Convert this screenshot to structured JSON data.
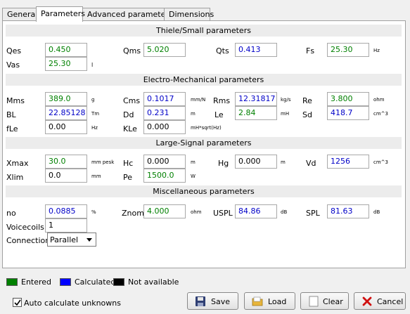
{
  "tabs": [
    "General",
    "Parameters",
    "Advanced parameters",
    "Dimensions"
  ],
  "sections": {
    "ts": "Thiele/Small parameters",
    "em": "Electro-Mechanical parameters",
    "ls": "Large-Signal parameters",
    "misc": "Miscellaneous parameters"
  },
  "params": {
    "qes": {
      "label": "Qes",
      "value": "0.450",
      "unit": ""
    },
    "qms": {
      "label": "Qms",
      "value": "5.020",
      "unit": ""
    },
    "qts": {
      "label": "Qts",
      "value": "0.413",
      "unit": ""
    },
    "fs": {
      "label": "Fs",
      "value": "25.30",
      "unit": "Hz"
    },
    "vas": {
      "label": "Vas",
      "value": "25.30",
      "unit": "l"
    },
    "mms": {
      "label": "Mms",
      "value": "389.0",
      "unit": "g"
    },
    "cms": {
      "label": "Cms",
      "value": "0.1017",
      "unit": "mm/N"
    },
    "rms": {
      "label": "Rms",
      "value": "12.31817",
      "unit": "kg/s"
    },
    "re": {
      "label": "Re",
      "value": "3.800",
      "unit": "ohm"
    },
    "bl": {
      "label": "BL",
      "value": "22.85128",
      "unit": "Tm"
    },
    "dd": {
      "label": "Dd",
      "value": "0.231",
      "unit": "m"
    },
    "le": {
      "label": "Le",
      "value": "2.84",
      "unit": "mH"
    },
    "sd": {
      "label": "Sd",
      "value": "418.7",
      "unit": "cm^3"
    },
    "fle": {
      "label": "fLe",
      "value": "0.00",
      "unit": "Hz"
    },
    "kle": {
      "label": "KLe",
      "value": "0.000",
      "unit": "mH*sqrt(Hz)"
    },
    "xmax": {
      "label": "Xmax",
      "value": "30.0",
      "unit": "mm  pesk"
    },
    "hc": {
      "label": "Hc",
      "value": "0.000",
      "unit": "m"
    },
    "hg": {
      "label": "Hg",
      "value": "0.000",
      "unit": "m"
    },
    "vd": {
      "label": "Vd",
      "value": "1256",
      "unit": "cm^3"
    },
    "xlim": {
      "label": "Xlim",
      "value": "0.0",
      "unit": "mm"
    },
    "pe": {
      "label": "Pe",
      "value": "1500.0",
      "unit": "W"
    },
    "no": {
      "label": "no",
      "value": "0.0885",
      "unit": "%"
    },
    "znom": {
      "label": "Znom",
      "value": "4.000",
      "unit": "ohm"
    },
    "uspl": {
      "label": "USPL",
      "value": "84.86",
      "unit": "dB"
    },
    "spl": {
      "label": "SPL",
      "value": "81.63",
      "unit": "dB"
    },
    "voicecoils": {
      "label": "Voicecoils",
      "value": "1"
    }
  },
  "connection": {
    "label": "Connection",
    "value": "Parallel"
  },
  "legend": {
    "entered": "Entered",
    "calculated": "Calculated",
    "na": "Not available"
  },
  "colors": {
    "entered": "#008000",
    "calculated": "#0000c8",
    "na": "#000000"
  },
  "autocalc": {
    "label": "Auto calculate unknowns",
    "checked": true
  },
  "buttons": {
    "save": "Save",
    "load": "Load",
    "clear": "Clear",
    "cancel": "Cancel"
  }
}
